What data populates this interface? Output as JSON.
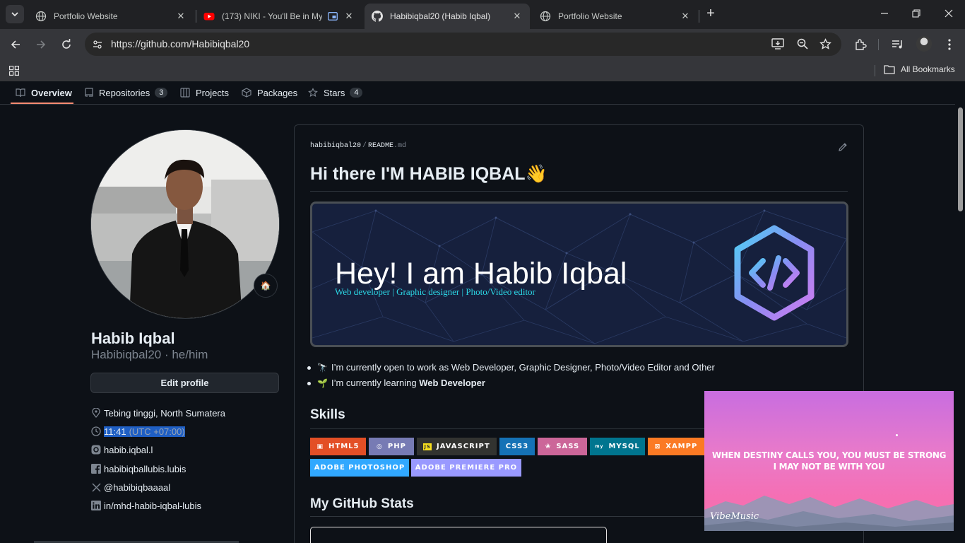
{
  "browser": {
    "tabs": [
      {
        "title": "Portfolio Website",
        "active": false
      },
      {
        "title": "(173) NIKI - You'll Be in My H",
        "active": false
      },
      {
        "title": "Habibiqbal20 (Habib Iqbal)",
        "active": true
      },
      {
        "title": "Portfolio Website",
        "active": false
      }
    ],
    "new_tab": "+",
    "url": "https://github.com/Habibiqbal20",
    "bookmarks_label": "All Bookmarks"
  },
  "profile_nav": {
    "overview": "Overview",
    "repositories": "Repositories",
    "repositories_count": "3",
    "projects": "Projects",
    "packages": "Packages",
    "stars": "Stars",
    "stars_count": "4"
  },
  "sidebar": {
    "name": "Habib Iqbal",
    "login": "Habibiqbal20 · he/him",
    "edit_profile": "Edit profile",
    "location": "Tebing tinggi, North Sumatera",
    "time": "11:41",
    "timezone": "(UTC +07:00)",
    "instagram": "habib.iqbal.l",
    "facebook": "habibiqballubis.lubis",
    "twitter": "@habibiqbaaaal",
    "linkedin": "in/mhd-habib-iqbal-lubis"
  },
  "readme": {
    "path_user": "habibiqbal20",
    "path_sep": "/",
    "path_file": "README",
    "path_ext": ".md",
    "heading": "Hi there I'M HABIB IQBAL",
    "heading_emoji": "👋",
    "banner_title": "Hey! I am Habib Iqbal",
    "banner_subtitle": "Web developer | Graphic designer | Photo/Video editor",
    "list": [
      {
        "emoji": "🔭",
        "text": "I’m currently open to work as Web Developer, Graphic Designer, Photo/Video Editor and Other",
        "bold": ""
      },
      {
        "emoji": "🌱",
        "text": "I’m currently learning ",
        "bold": "Web Developer"
      }
    ],
    "skills_heading": "Skills",
    "skills": [
      {
        "label": "HTML5",
        "color": "#e34f26"
      },
      {
        "label": "PHP",
        "color": "#777bb4"
      },
      {
        "label": "JAVASCRIPT",
        "color": "#323330"
      },
      {
        "label": "CSS3",
        "color": "#1572b6"
      },
      {
        "label": "SASS",
        "color": "#cc6699"
      },
      {
        "label": "MYSQL",
        "color": "#00758f"
      },
      {
        "label": "XAMPP",
        "color": "#fb7a24"
      },
      {
        "label": "ADOBE PHOTOSHOP",
        "color": "#31a8ff"
      },
      {
        "label": "ADOBE PREMIERE PRO",
        "color": "#9999ff"
      }
    ],
    "stats_heading": "My GitHub Stats"
  },
  "pip": {
    "line1": "WHEN DESTINY CALLS YOU, YOU MUST BE STRONG",
    "line2": "I MAY NOT BE WITH YOU",
    "logo": "VibeMusic"
  }
}
